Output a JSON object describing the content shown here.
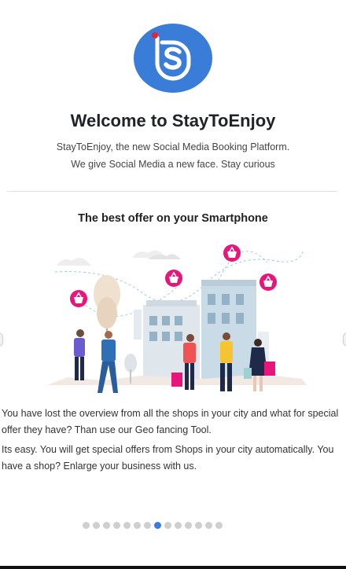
{
  "header": {
    "title": "Welcome to StayToEnjoy",
    "subtitle_line1": "StayToEnjoy, the new Social Media Booking Platform.",
    "subtitle_line2": "We give Social Media a new face. Stay curious"
  },
  "slide": {
    "title": "The best offer on your Smartphone",
    "paragraph1": "You have lost the overview from all the shops in your city and what for special offer they have? Than use our Geo fancing Tool.",
    "paragraph2": "Its easy. You will get special offers from Shops in your city automatically. You have a shop? Enlarge your business with us."
  },
  "carousel": {
    "total": 14,
    "active_index": 7
  },
  "colors": {
    "logo_blue": "#3a7dd8",
    "logo_dot": "#e2233b",
    "basket_pink": "#e8157a",
    "active_dot": "#3a7dd8"
  },
  "icons": [
    "logo-icon",
    "shopping-basket-icon",
    "chevron-left-icon",
    "chevron-right-icon"
  ]
}
